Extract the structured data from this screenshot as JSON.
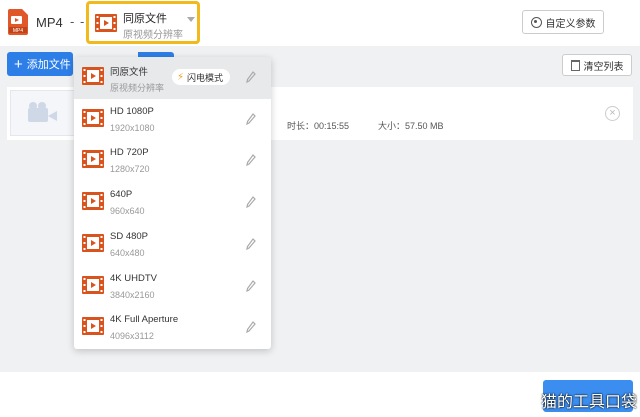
{
  "topbar": {
    "format_label": "MP4",
    "dashes": "- -",
    "preset_title": "同原文件",
    "preset_subtitle": "原视频分辨率",
    "custom_params_label": "自定义参数"
  },
  "toolbar": {
    "add_file_label": "添加文件",
    "clear_list_label": "清空列表"
  },
  "file": {
    "duration": "时长：00:15:55",
    "size": "大小：57.50 MB"
  },
  "dropdown": {
    "items": [
      {
        "name": "同原文件",
        "res": "原视频分辨率",
        "badge": "闪电模式",
        "selected": true
      },
      {
        "name": "HD 1080P",
        "res": "1920x1080"
      },
      {
        "name": "HD 720P",
        "res": "1280x720"
      },
      {
        "name": "640P",
        "res": "960x640"
      },
      {
        "name": "SD 480P",
        "res": "640x480"
      },
      {
        "name": "4K UHDTV",
        "res": "3840x2160"
      },
      {
        "name": "4K Full Aperture",
        "res": "4096x3112"
      }
    ]
  },
  "watermark": "猫的工具口袋",
  "colors": {
    "accent": "#2e7ee8",
    "highlight": "#f2b91c",
    "film": "#d9531e"
  }
}
